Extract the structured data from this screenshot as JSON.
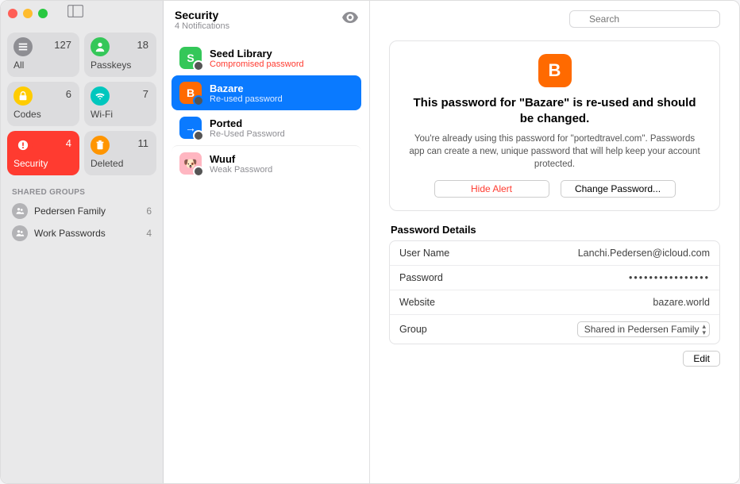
{
  "search": {
    "placeholder": "Search"
  },
  "sidebar": {
    "tiles": [
      {
        "label": "All",
        "count": "127",
        "icon": "list",
        "bg": "#8e8e93"
      },
      {
        "label": "Passkeys",
        "count": "18",
        "icon": "person",
        "bg": "#34c759"
      },
      {
        "label": "Codes",
        "count": "6",
        "icon": "lock",
        "bg": "#ffcc00"
      },
      {
        "label": "Wi-Fi",
        "count": "7",
        "icon": "wifi",
        "bg": "#00c7be"
      },
      {
        "label": "Security",
        "count": "4",
        "icon": "alert",
        "bg": "#ff3b30",
        "active": true
      },
      {
        "label": "Deleted",
        "count": "11",
        "icon": "trash",
        "bg": "#ff9500"
      }
    ],
    "shared_header": "SHARED GROUPS",
    "groups": [
      {
        "label": "Pedersen Family",
        "count": "6"
      },
      {
        "label": "Work Passwords",
        "count": "4"
      }
    ]
  },
  "middle": {
    "title": "Security",
    "subtitle": "4 Notifications",
    "items": [
      {
        "title": "Seed Library",
        "sub": "Compromised password",
        "warn": true,
        "iconBg": "#34c759",
        "iconLetter": "S"
      },
      {
        "title": "Bazare",
        "sub": "Re-used password",
        "iconBg": "#ff6a00",
        "iconLetter": "B",
        "selected": true
      },
      {
        "title": "Ported",
        "sub": "Re-Used Password",
        "iconBg": "#0a7aff",
        "iconLetter": "→"
      },
      {
        "title": "Wuuf",
        "sub": "Weak Password",
        "iconBg": "#ffb6c1",
        "iconLetter": "🐶"
      }
    ]
  },
  "detail": {
    "alert": {
      "iconBg": "#ff6a00",
      "iconLetter": "B",
      "title": "This password for \"Bazare\" is re-used and should be changed.",
      "body": "You're already using this password for \"portedtravel.com\". Passwords app can create a new, unique password that will help keep your account protected.",
      "hide_label": "Hide Alert",
      "change_label": "Change Password..."
    },
    "details_title": "Password Details",
    "rows": {
      "username_label": "User Name",
      "username_value": "Lanchi.Pedersen@icloud.com",
      "password_label": "Password",
      "password_value": "••••••••••••••••",
      "website_label": "Website",
      "website_value": "bazare.world",
      "group_label": "Group",
      "group_value": "Shared in Pedersen Family"
    },
    "edit_label": "Edit"
  }
}
